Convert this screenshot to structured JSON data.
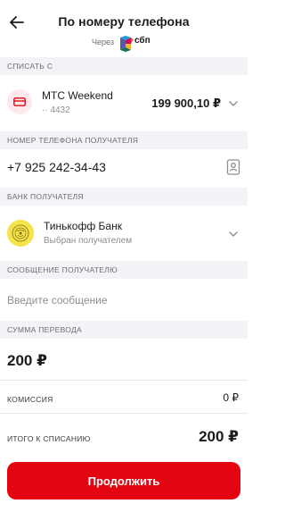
{
  "header": {
    "title": "По номеру телефона",
    "via_label": "Через",
    "sbp_logo_text": "сбп",
    "back_icon": "arrow-left-icon"
  },
  "debit": {
    "section_title": "Списать с",
    "account_name": "МТС Weekend",
    "account_number": "·· 4432",
    "balance": "199 900,10 ₽",
    "card_icon": "card-icon",
    "accent_color": "#e30611"
  },
  "recipient_phone": {
    "section_title": "Номер телефона получателя",
    "value": "+7 925 242-34-43",
    "contact_icon": "contacts-book-icon"
  },
  "recipient_bank": {
    "section_title": "Банк получателя",
    "bank_name": "Тинькофф Банк",
    "status": "Выбран получателем",
    "logo_color": "#f5e34a"
  },
  "message": {
    "section_title": "Сообщение получателю",
    "placeholder": "Введите сообщение",
    "value": ""
  },
  "transfer": {
    "section_title": "Сумма перевода",
    "amount": "200 ₽",
    "commission_label": "Комиссия",
    "commission_value": "0 ₽",
    "total_label": "Итого к списанию",
    "total_value": "200 ₽"
  },
  "actions": {
    "continue_label": "Продолжить",
    "button_color": "#e30611"
  }
}
